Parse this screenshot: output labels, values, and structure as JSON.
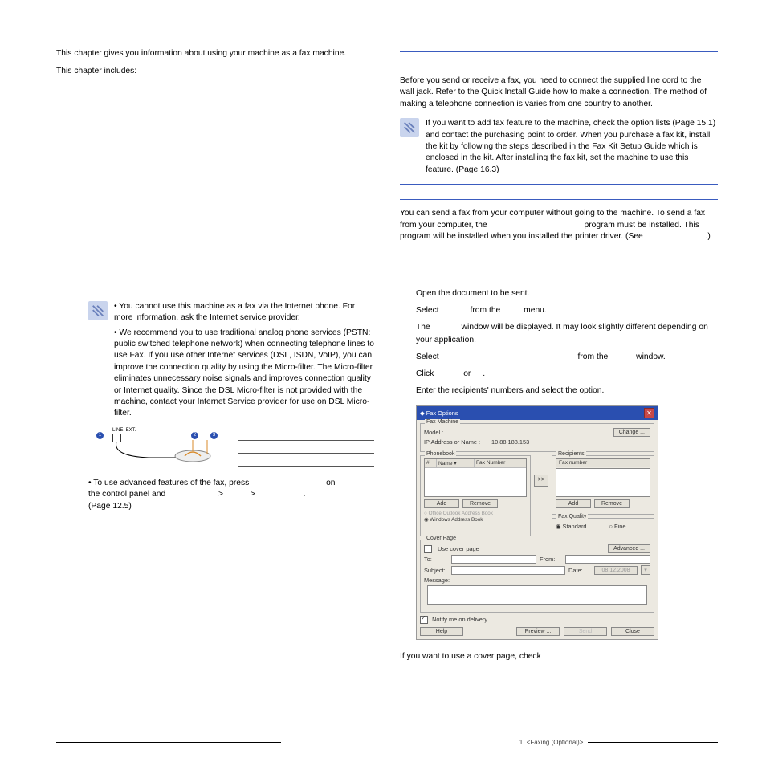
{
  "left": {
    "intro1": "This chapter gives you information about using your machine as a fax machine.",
    "intro2": "This chapter includes:",
    "note1_l1": "• You cannot use this machine as a fax via the Internet phone. For more information, ask the Internet service provider.",
    "note1_l2": "• We recommend you to use traditional analog phone services (PSTN: public switched telephone network) when connecting telephone lines to use Fax. If you use other Internet services (DSL, ISDN, VoIP), you can improve the connection quality by using the Micro-filter. The Micro-filter eliminates unnecessary noise signals and improves connection quality or Internet quality. Since the DSL Micro-filter is not provided with the machine, contact your Internet Service provider for use on DSL Micro-filter.",
    "adv_a": "• To use advanced features of the fax, press",
    "adv_a2": "on",
    "adv_b": "the control panel and",
    "adv_g": ">",
    "adv_e": ".",
    "adv_pg": "(Page 12.5)"
  },
  "right": {
    "p1": "Before you send or receive a fax, you need to connect the supplied line cord to the wall jack. Refer to the Quick Install Guide how to make a connection. The method of making a telephone connection is varies from one country to another.",
    "note2": "If you want to add fax feature to the machine, check the option lists (Page 15.1) and contact the purchasing point to order. When you purchase a fax kit, install the kit by following the steps described in the Fax Kit Setup Guide which is enclosed in the kit. After installing the fax kit, set the machine to use this feature. (Page 16.3)",
    "p2a": "You can send a fax from your computer without going to the machine. To send a fax from your computer, the",
    "p2b": "program",
    "p2c": "must be installed. This program will be installed when you installed the printer driver. (See",
    "p2d": ".)"
  },
  "steps": {
    "s1": "Open the document to be sent.",
    "s2a": "Select",
    "s2b": "from the",
    "s2c": "menu.",
    "s3a": "The",
    "s3b": "window will be displayed. It may look slightly different depending on your application.",
    "s4a": "Select",
    "s4b": "from the",
    "s4c": "window.",
    "s5a": "Click",
    "s5b": "or",
    "s5c": ".",
    "s6": "Enter the recipients' numbers and select the option.",
    "after": "If you want to use a cover page, check"
  },
  "dialog": {
    "title": "Fax Options",
    "fm_grp": "Fax Machine",
    "model_lbl": "Model :",
    "model_val": "",
    "ip_lbl": "IP Address or Name :",
    "ip_val": "10.88.188.153",
    "change": "Change ...",
    "pb_grp": "Phonebook",
    "pb_h0": "#",
    "pb_h1": "Name   ▾",
    "pb_h2": "Fax Number",
    "arrow": ">>",
    "add": "Add",
    "remove": "Remove",
    "oab": "Office Outlook Address Book",
    "wab": "Windows Address Book",
    "rec_grp": "Recipients",
    "rec_head": "Fax number",
    "fq_grp": "Fax Quality",
    "std": "Standard",
    "fine": "Fine",
    "cp_grp": "Cover Page",
    "ucp": "Use cover page",
    "advanced": "Advanced ...",
    "to": "To:",
    "from": "From:",
    "subject": "Subject:",
    "date": "Date:",
    "date_val": "08.12.2008",
    "message": "Message:",
    "notify": "Notify me on delivery",
    "help": "Help",
    "preview": "Preview ...",
    "send": "Send",
    "close": "Close"
  },
  "footer": {
    "num": ".1",
    "txt": "<Faxing (Optional)>"
  }
}
